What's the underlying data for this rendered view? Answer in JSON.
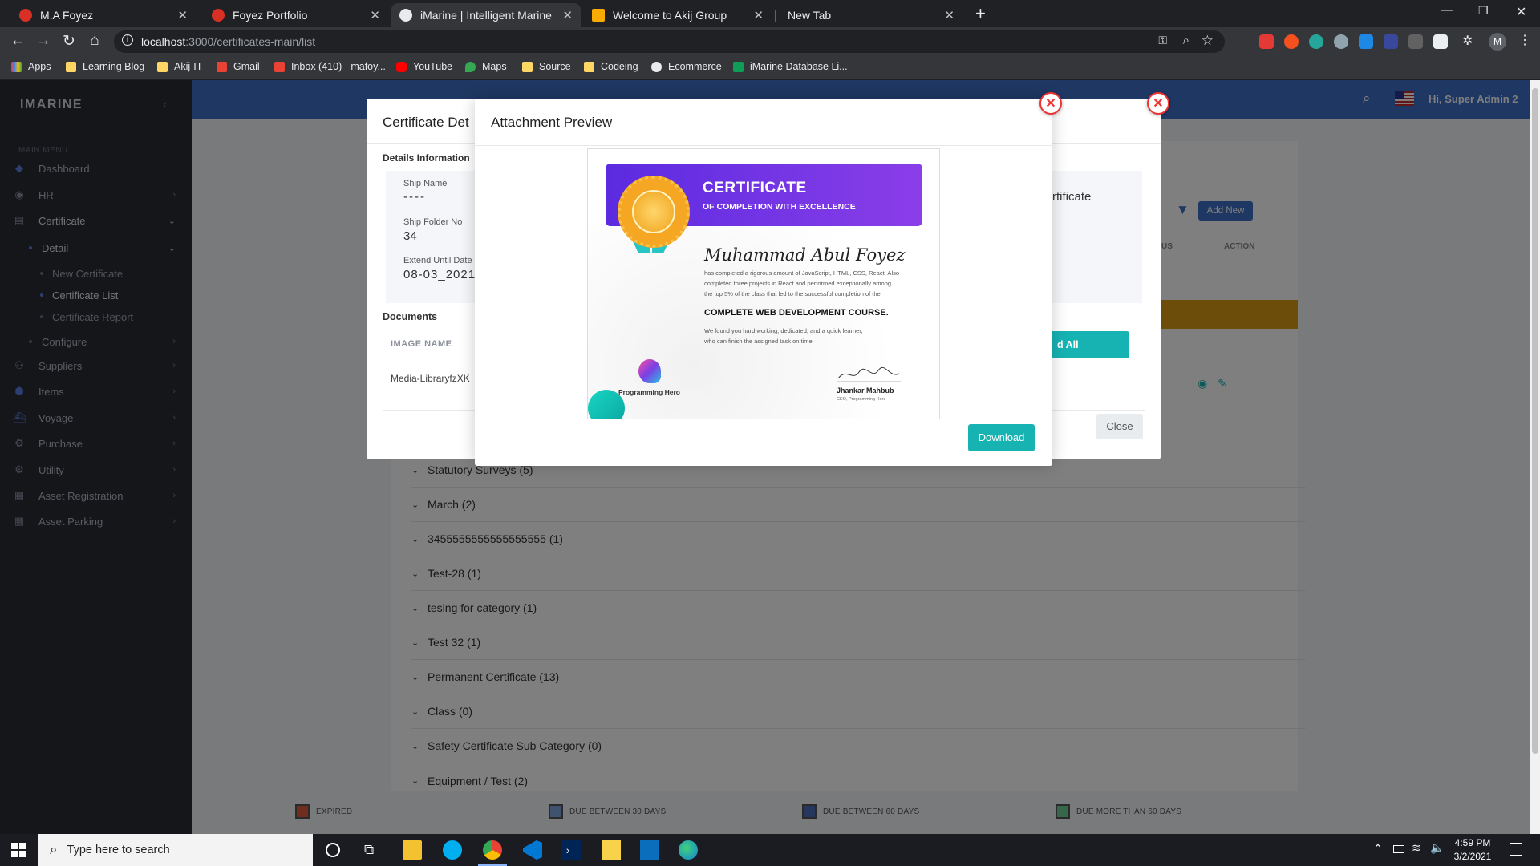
{
  "browser": {
    "tabs": [
      {
        "title": "M.A Foyez",
        "color": "#d93025"
      },
      {
        "title": "Foyez Portfolio",
        "color": "#d93025"
      },
      {
        "title": "iMarine | Intelligent Marine Mana",
        "color": "#e8eaed"
      },
      {
        "title": "Welcome to Akij Group",
        "color": "#f9ab00"
      },
      {
        "title": "New Tab",
        "color": ""
      }
    ],
    "url_host": "localhost",
    "url_path": ":3000/certificates-main/list",
    "bookmarks": [
      "Apps",
      "Learning Blog",
      "Akij-IT",
      "Gmail",
      "Inbox (410) - mafoy...",
      "YouTube",
      "Maps",
      "Source",
      "Codeing",
      "Ecommerce",
      "iMarine Database Li..."
    ],
    "profile_initial": "M"
  },
  "app": {
    "brand": "IMARINE",
    "menu_header": "MAIN MENU",
    "sidebar": {
      "dashboard": "Dashboard",
      "hr": "HR",
      "certificate": "Certificate",
      "detail": "Detail",
      "new_certificate": "New Certificate",
      "certificate_list": "Certificate List",
      "certificate_report": "Certificate Report",
      "configure": "Configure",
      "suppliers": "Suppliers",
      "items": "Items",
      "voyage": "Voyage",
      "purchase": "Purchase",
      "utility": "Utility",
      "asset_registration": "Asset Registration",
      "asset_parking": "Asset Parking"
    },
    "header_user": "Hi, Super Admin 2",
    "add_new": "Add New",
    "col_status": "US",
    "col_action": "ACTION",
    "categories": [
      "Statutory Surveys (5)",
      "March (2)",
      "3455555555555555555 (1)",
      "Test-28 (1)",
      "tesing for category (1)",
      "Test 32 (1)",
      "Permanent Certificate (13)",
      "Class (0)",
      "Safety Certificate Sub Category (0)",
      "Equipment / Test (2)"
    ],
    "legend": [
      "EXPIRED",
      "DUE BETWEEN 30 DAYS",
      "DUE BETWEEN 60 DAYS",
      "DUE MORE THAN 60 DAYS"
    ]
  },
  "detail_modal": {
    "title": "Certificate Det",
    "section": "Details Information",
    "ship_name_label": "Ship Name",
    "ship_name_value": "----",
    "folder_label": "Ship Folder No",
    "folder_value": "34",
    "extend_label": "Extend Until Date",
    "extend_value": "08-03_2021",
    "right_text": "rtificate",
    "documents": "Documents",
    "image_name_header": "IMAGE NAME",
    "image_name_value": "Media-LibraryfzXK",
    "download_all": "d All Documents",
    "close": "Close"
  },
  "preview_modal": {
    "title": "Attachment Preview",
    "download": "Download",
    "certificate": {
      "heading": "CERTIFICATE",
      "subheading": "OF COMPLETION WITH EXCELLENCE",
      "name": "Muhammad Abul Foyez",
      "body1": "has completed a rigorous amount of JavaScript, HTML, CSS, React. Also",
      "body2": "completed three projects in React and performed exceptionally among",
      "body3": "the top 5% of the class that led to the successful completion of the",
      "course": "COMPLETE WEB DEVELOPMENT COURSE.",
      "note1": "We found you hard working, dedicated, and a quick learner,",
      "note2": "who can finish the assigned task on time.",
      "brand": "Programming Hero",
      "signer": "Jhankar Mahbub",
      "signer_title": "CEO, Programming Hero"
    }
  },
  "taskbar": {
    "search_placeholder": "Type here to search",
    "time": "4:59 PM",
    "date": "3/2/2021"
  },
  "colors": {
    "header_blue": "#3f6fc7",
    "teal": "#17b3b3",
    "orange_row": "#d99a12",
    "cert_purple": "#6a2fe0"
  }
}
